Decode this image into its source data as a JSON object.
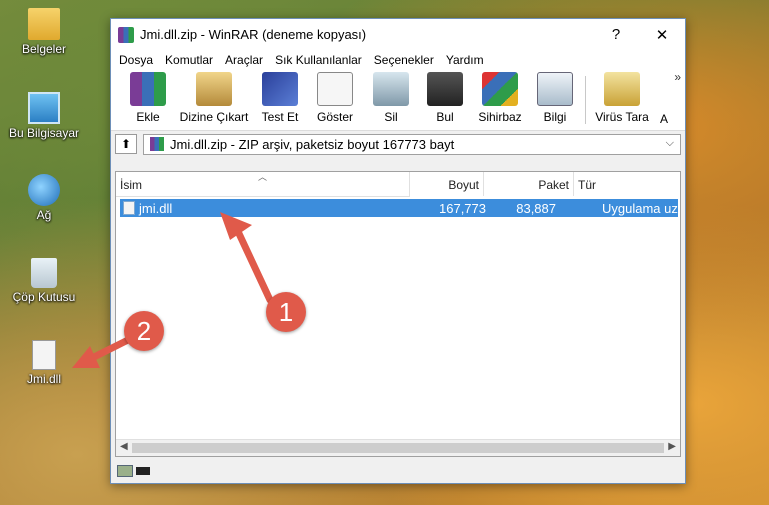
{
  "desktop": {
    "icons": [
      {
        "label": "Belgeler",
        "icon": "folder-icon"
      },
      {
        "label": "Bu Bilgisayar",
        "icon": "computer-icon"
      },
      {
        "label": "Ağ",
        "icon": "network-icon"
      },
      {
        "label": "Çöp Kutusu",
        "icon": "recycle-bin-icon"
      },
      {
        "label": "Jmi.dll",
        "icon": "dll-file-icon"
      }
    ]
  },
  "annotations": {
    "badge1": "1",
    "badge2": "2",
    "color": "#e05a4a"
  },
  "window": {
    "title": "Jmi.dll.zip - WinRAR (deneme kopyası)",
    "help_glyph": "?",
    "close_glyph": "✕",
    "menu": [
      "Dosya",
      "Komutlar",
      "Araçlar",
      "Sık Kullanılanlar",
      "Seçenekler",
      "Yardım"
    ],
    "toolbar": [
      {
        "label": "Ekle",
        "icon": "add-icon"
      },
      {
        "label": "Dizine Çıkart",
        "icon": "extract-icon"
      },
      {
        "label": "Test Et",
        "icon": "test-icon"
      },
      {
        "label": "Göster",
        "icon": "view-icon"
      },
      {
        "label": "Sil",
        "icon": "delete-icon"
      },
      {
        "label": "Bul",
        "icon": "find-icon"
      },
      {
        "label": "Sihirbaz",
        "icon": "wizard-icon"
      },
      {
        "label": "Bilgi",
        "icon": "info-icon"
      },
      {
        "label": "Virüs Tara",
        "icon": "virus-scan-icon"
      },
      {
        "label": "A",
        "icon": ""
      }
    ],
    "toolbar_more": "»",
    "address": "Jmi.dll.zip - ZIP arşiv, paketsiz boyut 167773 bayt",
    "columns": {
      "name": "İsim",
      "size": "Boyut",
      "packed": "Paket",
      "type": "Tür"
    },
    "files": [
      {
        "name": "jmi.dll",
        "size": "167,773",
        "packed": "83,887",
        "type": "Uygulama uzantısı"
      }
    ],
    "selection_color": "#3c8ddc"
  }
}
